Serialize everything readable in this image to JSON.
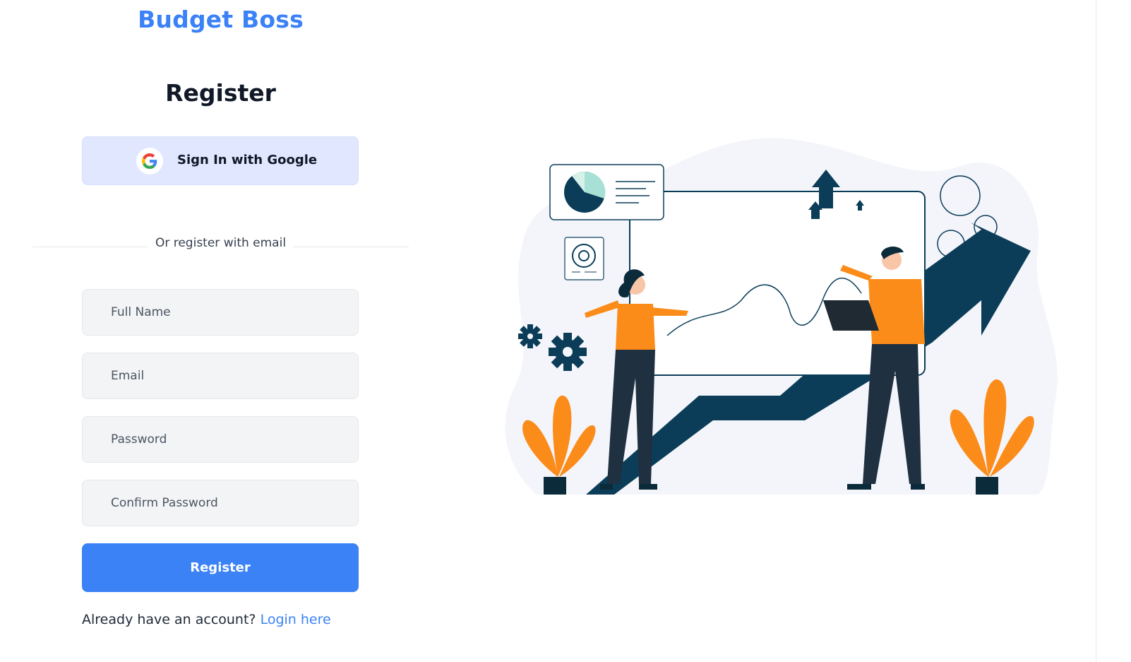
{
  "app": {
    "brand": "Budget Boss"
  },
  "form": {
    "title": "Register",
    "google_button_label": "Sign In with Google",
    "divider_text": "Or register with email",
    "fields": {
      "full_name": {
        "placeholder": "Full Name",
        "value": ""
      },
      "email": {
        "placeholder": "Email",
        "value": ""
      },
      "password": {
        "placeholder": "Password",
        "value": ""
      },
      "confirm_password": {
        "placeholder": "Confirm Password",
        "value": ""
      }
    },
    "submit_label": "Register",
    "login_prompt": "Already have an account?",
    "login_link": "Login here"
  },
  "colors": {
    "accent": "#3b82f6",
    "google_button_bg": "#e0e7ff",
    "field_bg": "#f3f4f6",
    "illustration_navy": "#0b3d59",
    "illustration_orange": "#fb8c1a"
  },
  "icons": {
    "google": "google-icon",
    "illustration": "growth-illustration"
  }
}
